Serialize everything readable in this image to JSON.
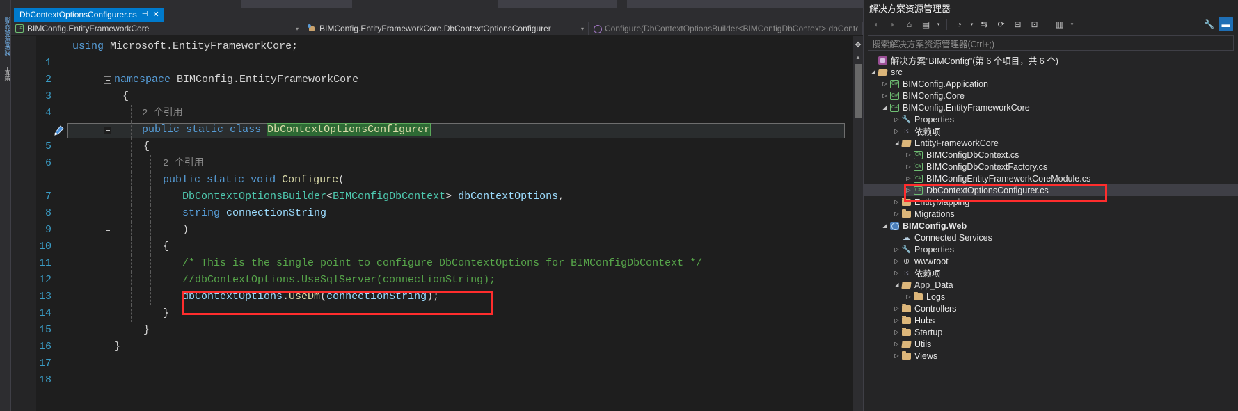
{
  "left_dock": {
    "tabs": [
      "服务器资源管理器",
      "工具箱"
    ]
  },
  "editor_tab": {
    "filename": "DbContextOptionsConfigurer.cs",
    "pin_icon": "pin-icon",
    "close_icon": "close-icon"
  },
  "nav_bar": {
    "project": "BIMConfig.EntityFrameworkCore",
    "type": "BIMConfig.EntityFrameworkCore.DbContextOptionsConfigurer",
    "member": "Configure(DbContextOptionsBuilder<BIMConfigDbContext> dbContextO",
    "caret": "▾"
  },
  "code": {
    "lines": [
      {
        "n": "1",
        "text": "using Microsoft.EntityFrameworkCore;"
      },
      {
        "n": "2",
        "text": ""
      },
      {
        "n": "3",
        "text": "namespace BIMConfig.EntityFrameworkCore"
      },
      {
        "n": "4",
        "text": "{"
      },
      {
        "n": "",
        "text": "2 个引用"
      },
      {
        "n": "5",
        "text": "public static class DbContextOptionsConfigurer"
      },
      {
        "n": "6",
        "text": "{"
      },
      {
        "n": "",
        "text": "2 个引用"
      },
      {
        "n": "7",
        "text": "public static void Configure("
      },
      {
        "n": "8",
        "text": "DbContextOptionsBuilder<BIMConfigDbContext> dbContextOptions,"
      },
      {
        "n": "9",
        "text": "string connectionString"
      },
      {
        "n": "10",
        "text": ")"
      },
      {
        "n": "11",
        "text": "{"
      },
      {
        "n": "12",
        "text": "/* This is the single point to configure DbContextOptions for BIMConfigDbContext */"
      },
      {
        "n": "13",
        "text": "//dbContextOptions.UseSqlServer(connectionString);"
      },
      {
        "n": "14",
        "text": "dbContextOptions.UseDm(connectionString);"
      },
      {
        "n": "15",
        "text": "}"
      },
      {
        "n": "16",
        "text": "}"
      },
      {
        "n": "17",
        "text": "}"
      },
      {
        "n": "18",
        "text": ""
      }
    ],
    "codelens_label": "2 个引用",
    "selected_class_name": "DbContextOptionsConfigurer",
    "highlight_color": "#2d6a34",
    "annotation_color": "#ff2d2d"
  },
  "solution_explorer": {
    "title": "解决方案资源管理器",
    "search_placeholder": "搜索解决方案资源管理器(Ctrl+;)",
    "toolbar": [
      {
        "name": "back-icon",
        "glyph": "◖"
      },
      {
        "name": "forward-icon",
        "glyph": "◗"
      },
      {
        "name": "home-icon",
        "glyph": "⌂"
      },
      {
        "name": "pending-changes-icon",
        "glyph": "▣"
      },
      {
        "name": "dropdown-caret-icon",
        "glyph": "▾"
      },
      {
        "name": "history-icon",
        "glyph": "◔"
      },
      {
        "name": "dropdown-caret-icon-2",
        "glyph": "▾"
      },
      {
        "name": "sync-icon",
        "glyph": "⇄"
      },
      {
        "name": "collapse-all-icon",
        "glyph": "⊟"
      },
      {
        "name": "show-all-files-icon",
        "glyph": "⊡"
      },
      {
        "name": "view-icon",
        "glyph": "▤"
      },
      {
        "name": "view-caret-icon",
        "glyph": "▾"
      },
      {
        "name": "properties-icon",
        "glyph": "🔧"
      },
      {
        "name": "preview-icon",
        "glyph": "▬"
      }
    ],
    "tree": [
      {
        "indent": 0,
        "expander": "",
        "icon": "solution-icon",
        "label": "解决方案\"BIMConfig\"(第 6 个项目，共 6 个)",
        "bold": false,
        "selected": false
      },
      {
        "indent": 0,
        "expander": "◢",
        "icon": "folder-open-icon",
        "label": "src",
        "bold": false,
        "selected": false
      },
      {
        "indent": 1,
        "expander": "▷",
        "icon": "csharp-project-icon",
        "label": "BIMConfig.Application",
        "bold": false,
        "selected": false
      },
      {
        "indent": 1,
        "expander": "▷",
        "icon": "csharp-project-icon",
        "label": "BIMConfig.Core",
        "bold": false,
        "selected": false
      },
      {
        "indent": 1,
        "expander": "◢",
        "icon": "csharp-project-icon",
        "label": "BIMConfig.EntityFrameworkCore",
        "bold": false,
        "selected": false
      },
      {
        "indent": 2,
        "expander": "▷",
        "icon": "wrench-icon",
        "label": "Properties",
        "bold": false,
        "selected": false
      },
      {
        "indent": 2,
        "expander": "▷",
        "icon": "dependencies-icon",
        "label": "依赖项",
        "bold": false,
        "selected": false
      },
      {
        "indent": 2,
        "expander": "◢",
        "icon": "folder-open-icon",
        "label": "EntityFrameworkCore",
        "bold": false,
        "selected": false
      },
      {
        "indent": 3,
        "expander": "▷",
        "icon": "csharp-file-icon",
        "label": "BIMConfigDbContext.cs",
        "bold": false,
        "selected": false
      },
      {
        "indent": 3,
        "expander": "▷",
        "icon": "csharp-file-icon",
        "label": "BIMConfigDbContextFactory.cs",
        "bold": false,
        "selected": false
      },
      {
        "indent": 3,
        "expander": "▷",
        "icon": "csharp-file-icon",
        "label": "BIMConfigEntityFrameworkCoreModule.cs",
        "bold": false,
        "selected": false
      },
      {
        "indent": 3,
        "expander": "▷",
        "icon": "csharp-file-icon",
        "label": "DbContextOptionsConfigurer.cs",
        "bold": false,
        "selected": true
      },
      {
        "indent": 2,
        "expander": "▷",
        "icon": "folder-icon",
        "label": "EntityMapping",
        "bold": false,
        "selected": false
      },
      {
        "indent": 2,
        "expander": "▷",
        "icon": "folder-icon",
        "label": "Migrations",
        "bold": false,
        "selected": false
      },
      {
        "indent": 1,
        "expander": "◢",
        "icon": "web-project-icon",
        "label": "BIMConfig.Web",
        "bold": true,
        "selected": false
      },
      {
        "indent": 2,
        "expander": "",
        "icon": "connected-services-icon",
        "label": "Connected Services",
        "bold": false,
        "selected": false
      },
      {
        "indent": 2,
        "expander": "▷",
        "icon": "wrench-icon",
        "label": "Properties",
        "bold": false,
        "selected": false
      },
      {
        "indent": 2,
        "expander": "▷",
        "icon": "globe-icon",
        "label": "wwwroot",
        "bold": false,
        "selected": false
      },
      {
        "indent": 2,
        "expander": "▷",
        "icon": "dependencies-icon",
        "label": "依赖项",
        "bold": false,
        "selected": false
      },
      {
        "indent": 2,
        "expander": "◢",
        "icon": "folder-open-icon",
        "label": "App_Data",
        "bold": false,
        "selected": false
      },
      {
        "indent": 3,
        "expander": "▷",
        "icon": "folder-icon",
        "label": "Logs",
        "bold": false,
        "selected": false
      },
      {
        "indent": 2,
        "expander": "▷",
        "icon": "folder-icon",
        "label": "Controllers",
        "bold": false,
        "selected": false
      },
      {
        "indent": 2,
        "expander": "▷",
        "icon": "folder-icon",
        "label": "Hubs",
        "bold": false,
        "selected": false
      },
      {
        "indent": 2,
        "expander": "▷",
        "icon": "folder-icon",
        "label": "Startup",
        "bold": false,
        "selected": false
      },
      {
        "indent": 2,
        "expander": "▷",
        "icon": "folder-open-icon",
        "label": "Utils",
        "bold": false,
        "selected": false
      },
      {
        "indent": 2,
        "expander": "▷",
        "icon": "folder-icon",
        "label": "Views",
        "bold": false,
        "selected": false
      }
    ]
  }
}
